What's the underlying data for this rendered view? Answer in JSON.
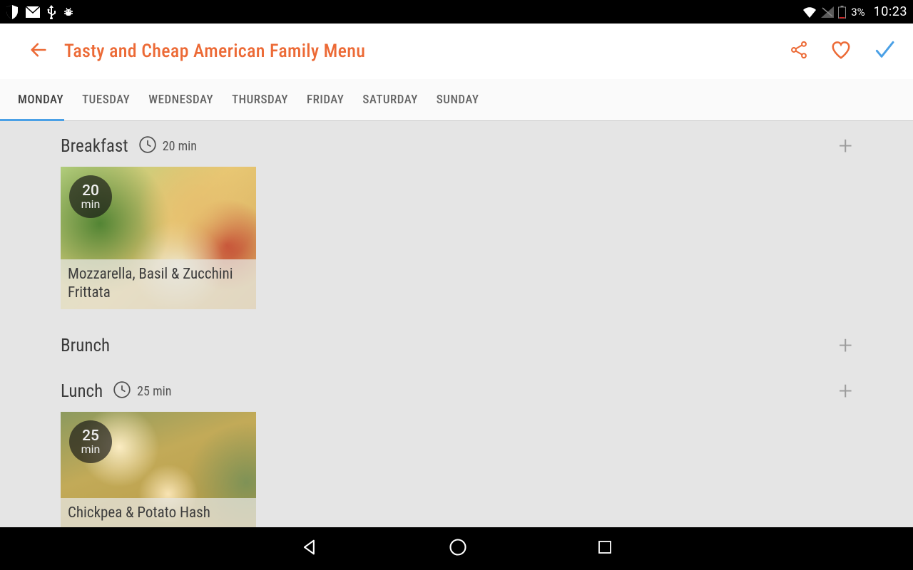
{
  "status": {
    "battery": "3%",
    "time": "10:23"
  },
  "header": {
    "title": "Tasty and Cheap American Family Menu"
  },
  "tabs": [
    {
      "label": "MONDAY",
      "active": true
    },
    {
      "label": "TUESDAY",
      "active": false
    },
    {
      "label": "WEDNESDAY",
      "active": false
    },
    {
      "label": "THURSDAY",
      "active": false
    },
    {
      "label": "FRIDAY",
      "active": false
    },
    {
      "label": "SATURDAY",
      "active": false
    },
    {
      "label": "SUNDAY",
      "active": false
    }
  ],
  "sections": {
    "breakfast": {
      "title": "Breakfast",
      "time": "20 min",
      "recipe": {
        "badge_num": "20",
        "badge_unit": "min",
        "name": "Mozzarella, Basil & Zucchini Frittata"
      }
    },
    "brunch": {
      "title": "Brunch"
    },
    "lunch": {
      "title": "Lunch",
      "time": "25 min",
      "recipe": {
        "badge_num": "25",
        "badge_unit": "min",
        "name": "Chickpea & Potato Hash"
      }
    }
  }
}
